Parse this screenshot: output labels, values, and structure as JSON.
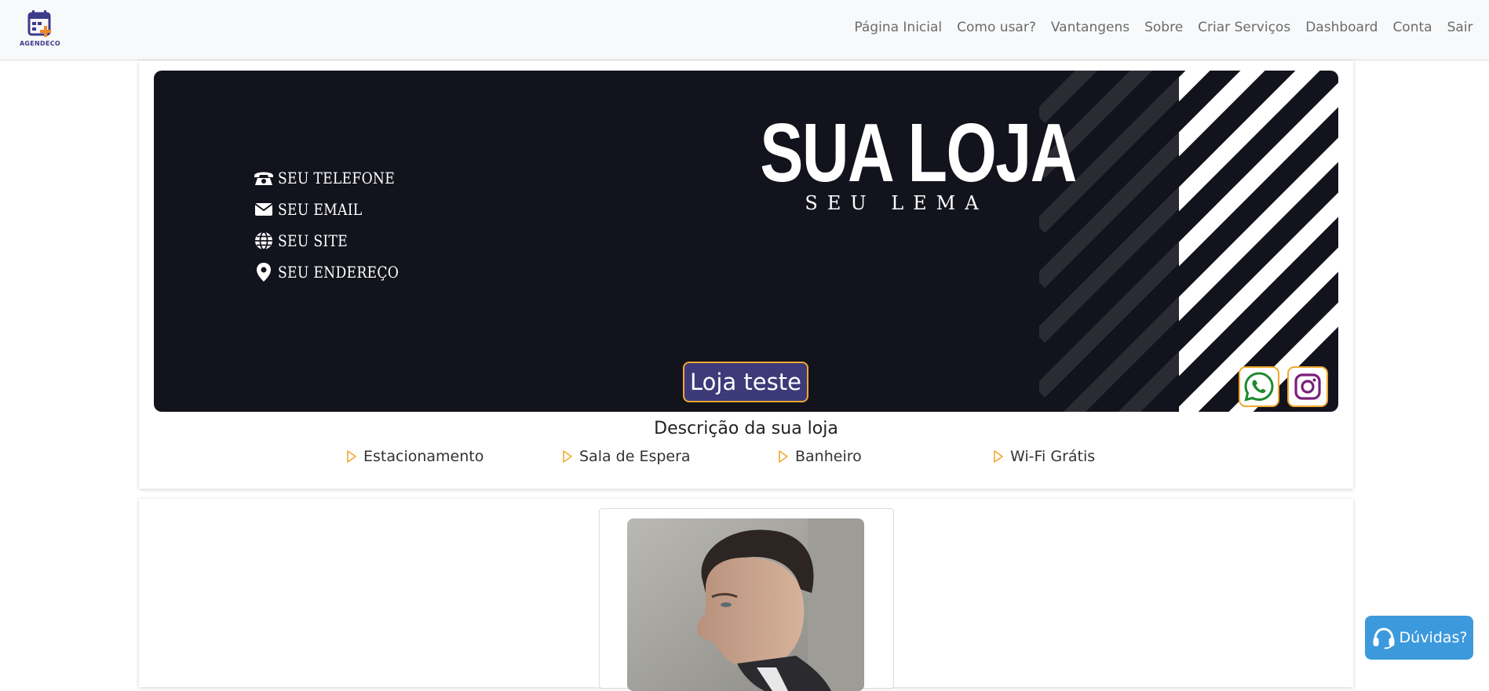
{
  "brand": {
    "name": "AGENDECO",
    "accent": "#3d3a8c",
    "orange": "#f08a24"
  },
  "nav": {
    "items": [
      {
        "label": "Página Inicial"
      },
      {
        "label": "Como usar?"
      },
      {
        "label": "Vantangens"
      },
      {
        "label": "Sobre"
      },
      {
        "label": "Criar Serviços"
      },
      {
        "label": "Dashboard"
      },
      {
        "label": "Conta"
      },
      {
        "label": "Sair"
      }
    ]
  },
  "banner": {
    "contacts": {
      "phone": "SEU TELEFONE",
      "email": "SEU EMAIL",
      "site": "SEU SITE",
      "address": "SEU ENDEREÇO"
    },
    "store_name": "SUA LOJA",
    "motto": "SEU LEMA",
    "store_button": "Loja teste",
    "background_color": "#12131c",
    "social": [
      {
        "icon": "whatsapp-icon",
        "color": "#1e8a2e"
      },
      {
        "icon": "instagram-icon",
        "color": "#7a1f7a"
      }
    ]
  },
  "store": {
    "description": "Descrição da sua loja",
    "amenities": [
      {
        "label": "Estacionamento",
        "icon": "triangle-right-icon"
      },
      {
        "label": "Sala de Espera",
        "icon": "triangle-right-icon"
      },
      {
        "label": "Banheiro",
        "icon": "triangle-right-icon"
      },
      {
        "label": "Wi-Fi Grátis",
        "icon": "triangle-right-icon"
      }
    ],
    "amenity_icon_color": "#f0a830"
  },
  "help": {
    "label": "Dúvidas?",
    "icon": "headset-icon",
    "color": "#3c99dc"
  }
}
